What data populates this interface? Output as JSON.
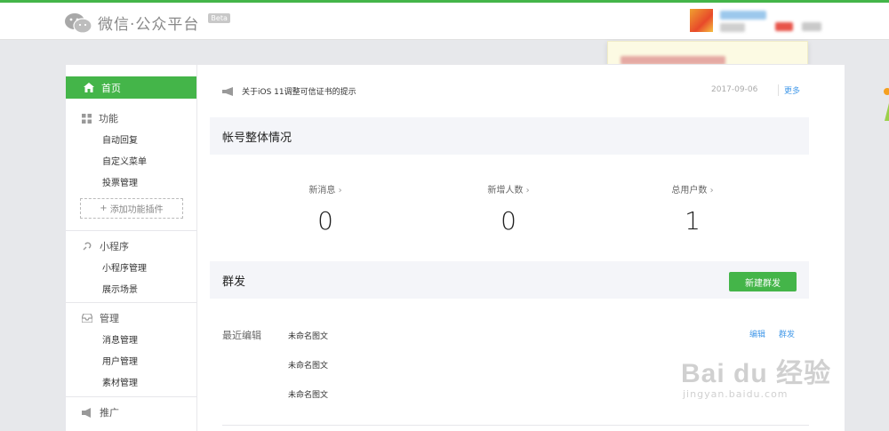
{
  "header": {
    "logo_text": "微信·公众平台",
    "beta": "Beta"
  },
  "sidebar": {
    "home": "首页",
    "sections": [
      {
        "title": "功能",
        "items": [
          "自动回复",
          "自定义菜单",
          "投票管理"
        ]
      },
      {
        "title": "小程序",
        "items": [
          "小程序管理",
          "展示场景"
        ]
      },
      {
        "title": "管理",
        "items": [
          "消息管理",
          "用户管理",
          "素材管理"
        ]
      },
      {
        "title": "推广",
        "items": []
      }
    ],
    "add_plugin": "添加功能插件"
  },
  "notice": {
    "text": "关于iOS 11调整可信证书的提示",
    "date": "2017-09-06",
    "more": "更多"
  },
  "account": {
    "title": "帐号整体情况",
    "stats": [
      {
        "label": "新消息",
        "value": "0"
      },
      {
        "label": "新增人数",
        "value": "0"
      },
      {
        "label": "总用户数",
        "value": "1"
      }
    ]
  },
  "mass": {
    "title": "群发",
    "new_button": "新建群发",
    "recent_label": "最近编辑",
    "drafts": [
      "未命名图文",
      "未命名图文",
      "未命名图文"
    ],
    "edit": "编辑",
    "send": "群发"
  },
  "watermark": {
    "main": "Bai du 经验",
    "sub": "jingyan.baidu.com"
  },
  "colors": {
    "accent": "#44b549",
    "link": "#459ae9",
    "panel": "#f4f5f9"
  }
}
